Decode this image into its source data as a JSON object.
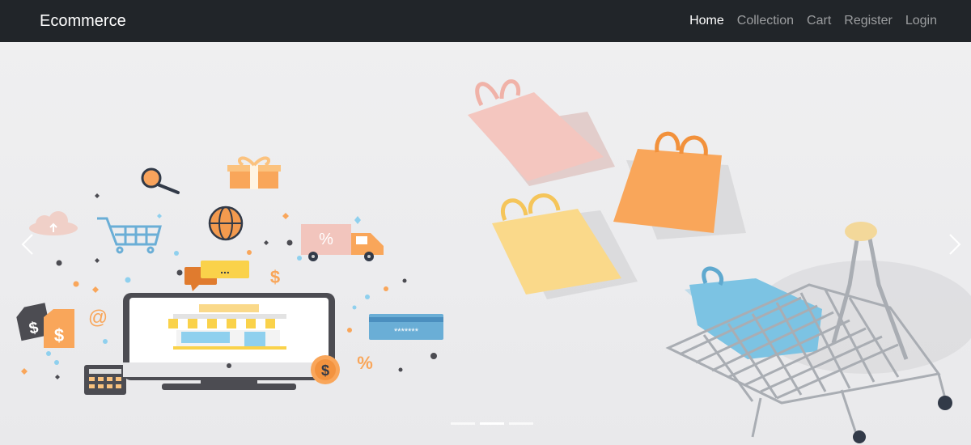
{
  "navbar": {
    "brand": "Ecommerce",
    "links": [
      {
        "label": "Home",
        "active": true
      },
      {
        "label": "Collection",
        "active": false
      },
      {
        "label": "Cart",
        "active": false
      },
      {
        "label": "Register",
        "active": false
      },
      {
        "label": "Login",
        "active": false
      }
    ]
  },
  "carousel": {
    "slide_count": 3,
    "active_slide": 2,
    "controls": {
      "prev_icon": "chevron-left-icon",
      "next_icon": "chevron-right-icon"
    },
    "illustration": {
      "percent_sign": "%",
      "dollar_sign": "$",
      "at_sign": "@",
      "chat_dots": "...",
      "card_mask": "*******"
    }
  },
  "colors": {
    "navbar_bg": "#212529",
    "bag_pink": "#f4c6bf",
    "bag_orange": "#f9a65a",
    "bag_yellow": "#fad98a",
    "bag_blue": "#7cc3e3"
  }
}
